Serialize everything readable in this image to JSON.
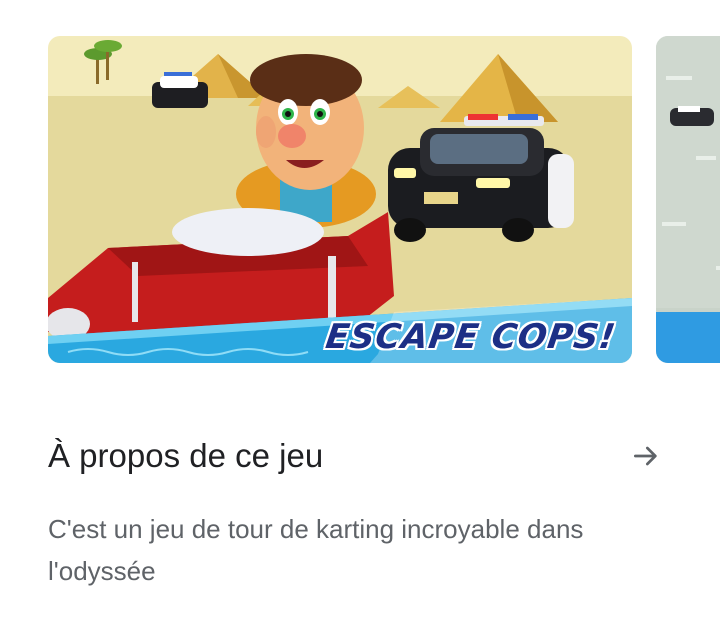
{
  "screenshots": {
    "items": [
      {
        "banner_text": "ESCAPE COPS!"
      },
      {
        "banner_text": ""
      }
    ]
  },
  "about": {
    "title": "À propos de ce jeu",
    "arrow_icon": "arrow-right-icon",
    "description": "C'est un jeu de tour de karting incroyable dans l'odyssée"
  },
  "colors": {
    "title": "#202124",
    "description": "#5f6368",
    "banner_blue": "#2aa8e0",
    "banner_text": "#1c2f86",
    "sand": "#e6dca0",
    "sky": "#f1e9b8",
    "kart_red": "#c81e1e"
  }
}
